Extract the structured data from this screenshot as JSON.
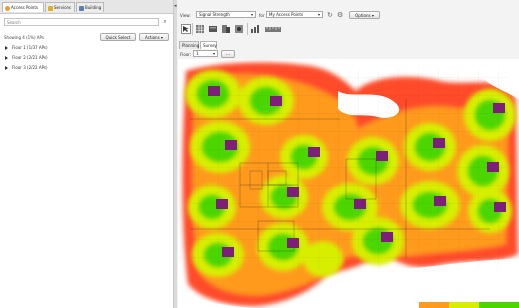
{
  "left_panel": {
    "tabs": [
      {
        "label": "Access Points",
        "icon": "access-points-tab-icon"
      },
      {
        "label": "Services",
        "icon": "services-tab-icon"
      },
      {
        "label": "Building",
        "icon": "building-tab-icon"
      }
    ],
    "search_placeholder": "Search",
    "showing_text": "Showing 4 (1%) APs",
    "quick_select_label": "Quick Select",
    "actions_label": "Actions ▾",
    "floors": [
      {
        "label": "Floor 1 (1/37 APs)"
      },
      {
        "label": "Floor 2 (2/21 APs)"
      },
      {
        "label": "Floor 3 (2/22 APs)"
      }
    ]
  },
  "toolbar": {
    "view_label": "View:",
    "view_value": "Signal Strength",
    "for_label": "for",
    "for_value": "My Access Points",
    "options_label": "Options ▾"
  },
  "tools": [
    "select-tool-icon",
    "grid-tool-icon",
    "wall-tool-icon",
    "door-tool-icon",
    "window-tool-icon",
    "chart-tool-icon",
    "measure-tool-icon"
  ],
  "view_tabs": [
    {
      "label": "Planning"
    },
    {
      "label": "Survey"
    }
  ],
  "floor_selector": {
    "label": "Floor:",
    "value": "1"
  },
  "colors": {
    "ap_label_bg": "#7c1e7a",
    "heat_strong": "#4cd600",
    "heat_good": "#d8ee00",
    "heat_fair": "#ff9a1f",
    "heat_weak": "#ff4b2c"
  }
}
